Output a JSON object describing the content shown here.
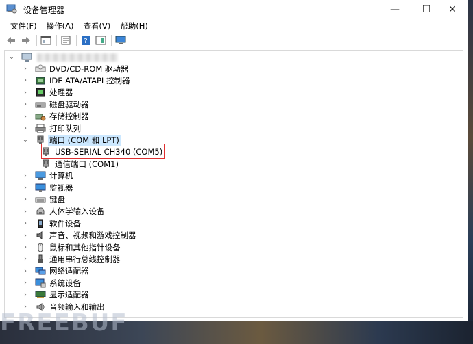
{
  "window": {
    "title": "设备管理器"
  },
  "window_buttons": {
    "minimize": "—",
    "maximize": "☐",
    "close": "✕"
  },
  "menu": [
    {
      "label": "文件(F)"
    },
    {
      "label": "操作(A)"
    },
    {
      "label": "查看(V)"
    },
    {
      "label": "帮助(H)"
    }
  ],
  "tree": {
    "items": [
      {
        "label": "DVD/CD-ROM 驱动器",
        "icon": "dvd-drive-icon"
      },
      {
        "label": "IDE ATA/ATAPI 控制器",
        "icon": "ide-controller-icon"
      },
      {
        "label": "处理器",
        "icon": "processor-icon"
      },
      {
        "label": "磁盘驱动器",
        "icon": "disk-drive-icon"
      },
      {
        "label": "存储控制器",
        "icon": "storage-controller-icon"
      },
      {
        "label": "打印队列",
        "icon": "printer-icon"
      },
      {
        "label": "端口 (COM 和 LPT)",
        "icon": "port-icon"
      },
      {
        "label": "USB-SERIAL CH340 (COM5)",
        "icon": "port-icon"
      },
      {
        "label": "通信端口 (COM1)",
        "icon": "port-icon"
      },
      {
        "label": "计算机",
        "icon": "computer-icon"
      },
      {
        "label": "监视器",
        "icon": "monitor-icon"
      },
      {
        "label": "键盘",
        "icon": "keyboard-icon"
      },
      {
        "label": "人体学输入设备",
        "icon": "hid-icon"
      },
      {
        "label": "软件设备",
        "icon": "software-device-icon"
      },
      {
        "label": "声音、视频和游戏控制器",
        "icon": "speaker-icon"
      },
      {
        "label": "鼠标和其他指针设备",
        "icon": "mouse-icon"
      },
      {
        "label": "通用串行总线控制器",
        "icon": "usb-icon"
      },
      {
        "label": "网络适配器",
        "icon": "network-icon"
      },
      {
        "label": "系统设备",
        "icon": "system-device-icon"
      },
      {
        "label": "显示适配器",
        "icon": "display-adapter-icon"
      },
      {
        "label": "音频输入和输出",
        "icon": "audio-io-icon"
      }
    ]
  },
  "watermark": "FREEBUF"
}
